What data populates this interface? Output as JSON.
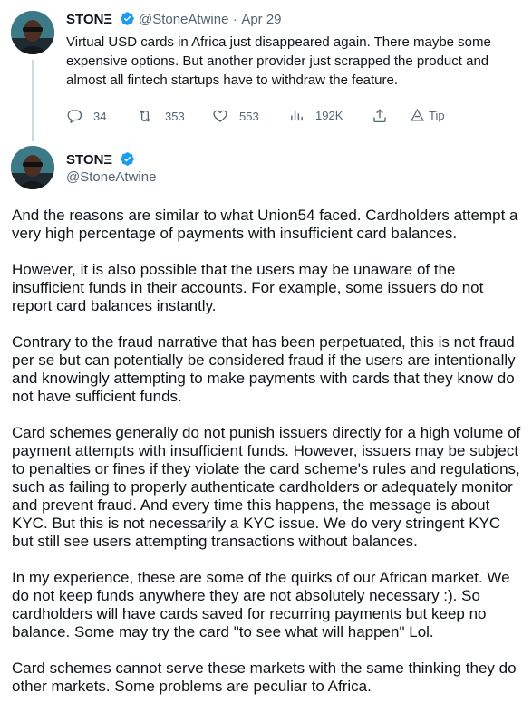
{
  "reply_tweet": {
    "name": "STONΞ",
    "handle": "@StoneAtwine",
    "separator": "·",
    "date": "Apr 29",
    "text": "Virtual USD cards in Africa just disappeared again. There maybe some expensive options. But another provider just scrapped the product and almost all fintech startups have to withdraw the feature.",
    "actions": {
      "replies": "34",
      "retweets": "353",
      "likes": "553",
      "views": "192K",
      "tip": "Tip"
    }
  },
  "main_tweet": {
    "name": "STONΞ",
    "handle": "@StoneAtwine",
    "paragraphs": [
      "And the reasons are similar to what Union54 faced. Cardholders attempt a very high percentage of payments with insufficient card balances.",
      "However, it is also possible that the users may be unaware of the insufficient funds in their accounts. For example, some issuers do not report card balances instantly.",
      "Contrary to the fraud narrative that has been perpetuated, this is not fraud per se but can potentially be considered fraud if the users are intentionally and knowingly attempting to make payments with cards that they know do not have sufficient funds.",
      "Card schemes generally do not punish issuers directly for a high volume of payment attempts with insufficient funds. However, issuers may be subject to penalties or fines if they violate the card scheme's rules and regulations, such as failing to properly authenticate cardholders or adequately monitor and prevent fraud. And every time this happens, the message is about KYC. But this is not necessarily a KYC issue. We do very stringent KYC but still see users attempting transactions without balances.",
      "In my experience, these are some of the quirks of our African market. We do not keep funds anywhere they are not absolutely necessary :). So cardholders will have cards saved for recurring payments but keep no balance. Some may try the card \"to see what will happen\" Lol.",
      "Card schemes cannot serve these markets with the same thinking they do other markets. Some problems are peculiar to Africa."
    ]
  },
  "colors": {
    "text": "#0f1419",
    "muted": "#536471",
    "verified": "#1d9bf0",
    "thread_line": "#cfd9de"
  }
}
